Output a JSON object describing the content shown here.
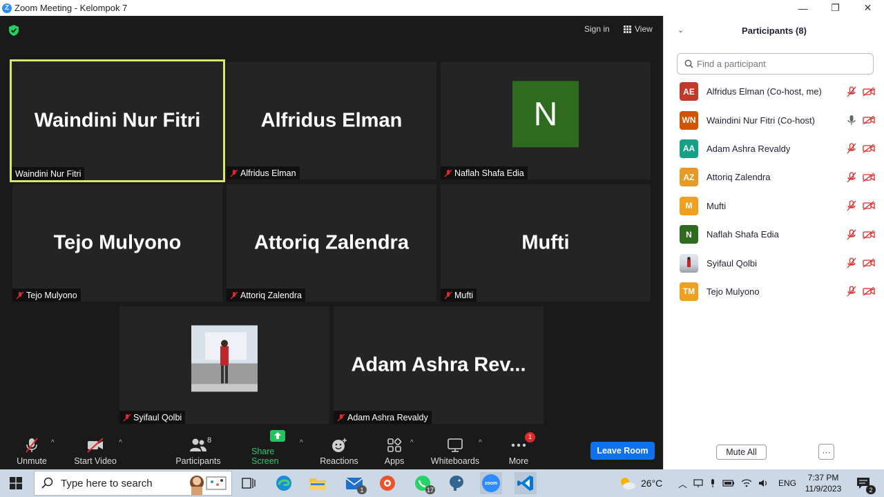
{
  "window": {
    "title": "Zoom Meeting - Kelompok 7",
    "minimize_glyph": "—",
    "restore_glyph": "❐",
    "close_glyph": "✕"
  },
  "topbar": {
    "sign_in": "Sign in",
    "view": "View"
  },
  "tiles": [
    {
      "big": "Waindini Nur Fitri",
      "label": "Waindini Nur Fitri",
      "muted": false,
      "active": true
    },
    {
      "big": "Alfridus Elman",
      "label": "Alfridus Elman",
      "muted": true
    },
    {
      "avatar_letter": "N",
      "label": "Naflah Shafa Edia",
      "muted": true
    },
    {
      "big": "Tejo Mulyono",
      "label": "Tejo Mulyono",
      "muted": true
    },
    {
      "big": "Attoriq Zalendra",
      "label": "Attoriq Zalendra",
      "muted": true
    },
    {
      "big": "Mufti",
      "label": "Mufti",
      "muted": true
    },
    {
      "photo": true,
      "label": "Syifaul Qolbi",
      "muted": true
    },
    {
      "big": "Adam Ashra Rev...",
      "label": "Adam Ashra Revaldy",
      "muted": true
    }
  ],
  "toolbar": {
    "unmute": "Unmute",
    "start_video": "Start Video",
    "participants": "Participants",
    "participants_count": "8",
    "share_screen": "Share Screen",
    "reactions": "Reactions",
    "apps": "Apps",
    "whiteboards": "Whiteboards",
    "more": "More",
    "more_badge": "1",
    "leave_room": "Leave Room",
    "caret_glyph": "^"
  },
  "panel": {
    "title": "Participants (8)",
    "collapse_glyph": "⌄",
    "search_placeholder": "Find a participant",
    "mute_all": "Mute All",
    "more_options": "···",
    "participants": [
      {
        "initials": "AE",
        "color": "#c0392b",
        "name": "Alfridus Elman (Co-host, me)",
        "mic": "muted"
      },
      {
        "initials": "WN",
        "color": "#d35400",
        "name": "Waindini Nur Fitri (Co-host)",
        "mic": "on"
      },
      {
        "initials": "AA",
        "color": "#16a085",
        "name": "Adam Ashra Revaldy",
        "mic": "muted"
      },
      {
        "initials": "AZ",
        "color": "#e69a28",
        "name": "Attoriq Zalendra",
        "mic": "muted"
      },
      {
        "initials": "M",
        "color": "#f0a020",
        "name": "Mufti",
        "mic": "muted"
      },
      {
        "initials": "N",
        "color": "#2e6b1f",
        "name": "Naflah Shafa Edia",
        "mic": "muted"
      },
      {
        "initials": "",
        "color": "#9aa5b1",
        "name": "Syifaul Qolbi",
        "mic": "muted",
        "photo": true
      },
      {
        "initials": "TM",
        "color": "#f0a020",
        "name": "Tejo Mulyono",
        "mic": "muted"
      }
    ]
  },
  "taskbar": {
    "search_placeholder": "Type here to search",
    "weather": "26°C",
    "language": "ENG",
    "time": "7:37 PM",
    "date": "11/9/2023",
    "mail_badge": "1",
    "whatsapp_badge": "17",
    "zoom_label": "zoom",
    "notif_badge": "2"
  }
}
